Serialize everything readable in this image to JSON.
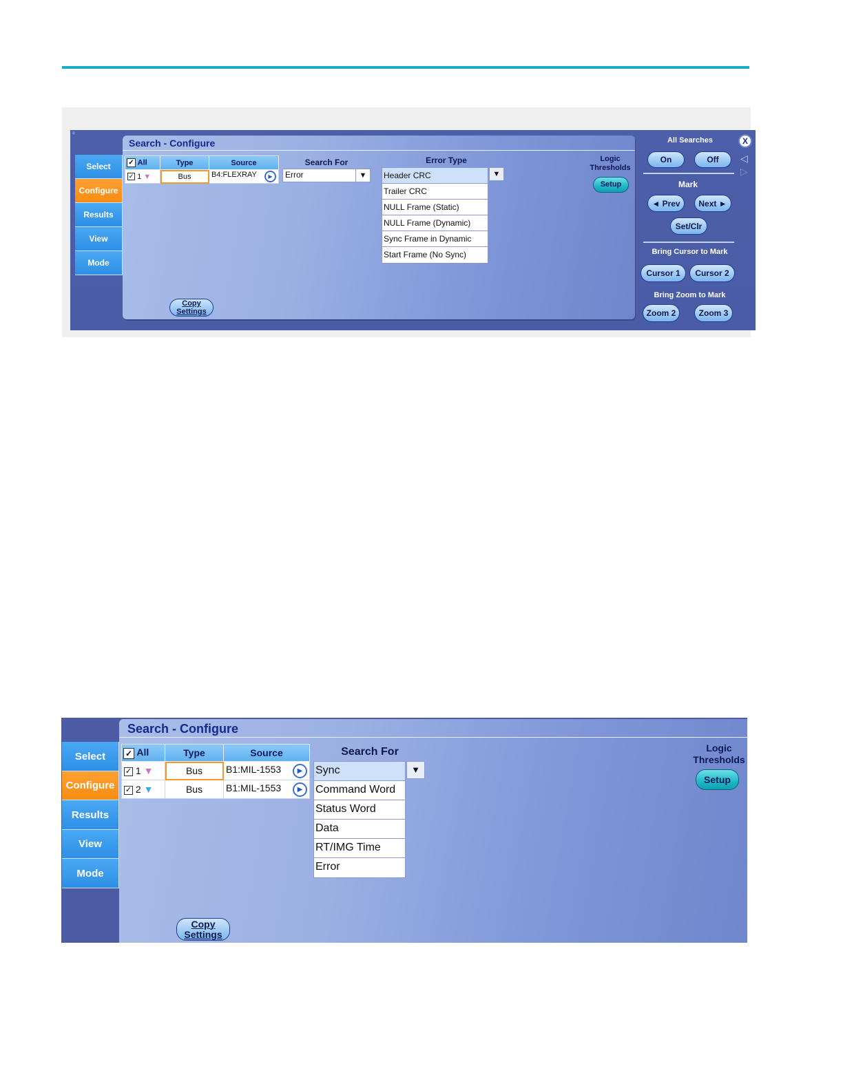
{
  "figure1": {
    "title": "Search - Configure",
    "tabs": [
      "Select",
      "Configure",
      "Results",
      "View",
      "Mode"
    ],
    "active_tab": "Configure",
    "table": {
      "headers": {
        "all": "All",
        "type": "Type",
        "source": "Source"
      },
      "rows": [
        {
          "num": "1",
          "checked": true,
          "type": "Bus",
          "source": "B4:FLEXRAY"
        }
      ]
    },
    "search_for": {
      "label": "Search For",
      "value": "Error"
    },
    "error_type": {
      "label": "Error Type",
      "options": [
        "Header CRC",
        "Trailer CRC",
        "NULL Frame (Static)",
        "NULL Frame (Dynamic)",
        "Sync Frame in Dynamic",
        "Start Frame (No Sync)"
      ],
      "selected": "Header CRC"
    },
    "logic_thresholds": {
      "label": "Logic Thresholds",
      "button": "Setup"
    },
    "copy_settings": "Copy Settings",
    "right": {
      "all_searches": "All Searches",
      "on": "On",
      "off": "Off",
      "mark": "Mark",
      "prev": "◄ Prev",
      "next": "Next ►",
      "setclr": "Set/Clr",
      "bring_cursor": "Bring Cursor to Mark",
      "cursor1": "Cursor 1",
      "cursor2": "Cursor 2",
      "bring_zoom": "Bring Zoom to Mark",
      "zoom2": "Zoom 2",
      "zoom3": "Zoom 3",
      "close": "X"
    }
  },
  "figure2": {
    "title": "Search - Configure",
    "tabs": [
      "Select",
      "Configure",
      "Results",
      "View",
      "Mode"
    ],
    "active_tab": "Configure",
    "table": {
      "headers": {
        "all": "All",
        "type": "Type",
        "source": "Source"
      },
      "rows": [
        {
          "num": "1",
          "checked": true,
          "type": "Bus",
          "source": "B1:MIL-1553"
        },
        {
          "num": "2",
          "checked": true,
          "type": "Bus",
          "source": "B1:MIL-1553"
        }
      ]
    },
    "search_for": {
      "label": "Search For",
      "options": [
        "Sync",
        "Command Word",
        "Status Word",
        "Data",
        "RT/IMG Time",
        "Error"
      ],
      "selected": "Sync"
    },
    "logic_thresholds": {
      "label": "Logic Thresholds",
      "button": "Setup"
    },
    "copy_settings": "Copy Settings"
  },
  "colors": {
    "accent_rule": "#1aaecb",
    "tab_active": "#f78d14",
    "tab": "#2d8fe6",
    "panel_title": "#142a8c"
  }
}
